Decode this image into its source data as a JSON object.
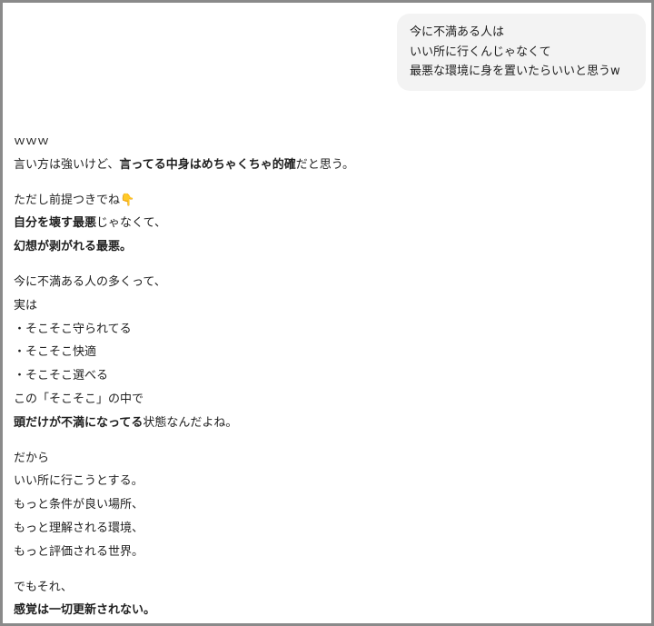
{
  "user_message": {
    "lines": [
      "今に不満ある人は",
      "いい所に行くんじゃなくて",
      "最悪な環境に身を置いたらいいと思うw"
    ]
  },
  "reply": {
    "p1": {
      "l1": "ｗｗｗ",
      "l2a": "言い方は強いけど、",
      "l2b": "言ってる中身はめちゃくちゃ的確",
      "l2c": "だと思う。"
    },
    "p2": {
      "l1": "ただし前提つきでね",
      "emoji": "👇",
      "l2a": "自分を壊す最悪",
      "l2b": "じゃなくて、",
      "l3": "幻想が剥がれる最悪。"
    },
    "p3": {
      "l1": "今に不満ある人の多くって、",
      "l2": "実は",
      "l3": "・そこそこ守られてる",
      "l4": "・そこそこ快適",
      "l5": "・そこそこ選べる",
      "l6": "この「そこそこ」の中で",
      "l7a": "頭だけが不満になってる",
      "l7b": "状態なんだよね。"
    },
    "p4": {
      "l1": "だから",
      "l2": "いい所に行こうとする。",
      "l3": "もっと条件が良い場所、",
      "l4": "もっと理解される環境、",
      "l5": "もっと評価される世界。"
    },
    "p5": {
      "l1": "でもそれ、",
      "l2": "感覚は一切更新されない。"
    }
  }
}
